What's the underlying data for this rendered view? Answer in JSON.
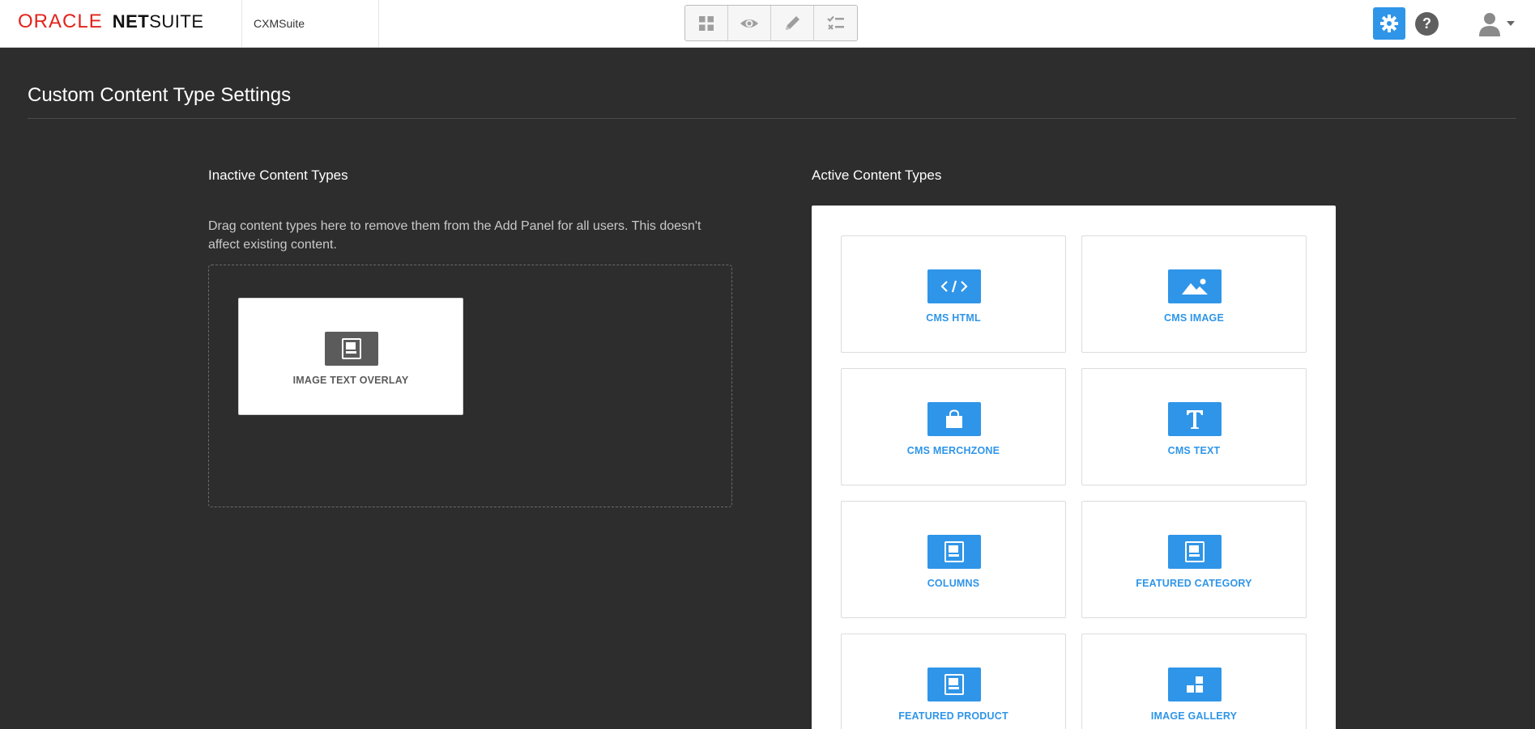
{
  "topbar": {
    "brand_oracle": "ORACLE",
    "brand_net": "NET",
    "brand_suite": "SUITE",
    "site_name": "CXMSuite",
    "modes": [
      {
        "icon": "grid-icon"
      },
      {
        "icon": "eye-icon"
      },
      {
        "icon": "pencil-icon"
      },
      {
        "icon": "checklist-icon"
      }
    ],
    "settings_icon": "gear-icon",
    "help_label": "?",
    "user_icon": "user-icon"
  },
  "page": {
    "title": "Custom Content Type Settings"
  },
  "inactive": {
    "heading": "Inactive Content Types",
    "description": "Drag content types here to remove them from the Add Panel for all users. This doesn't affect existing content.",
    "items": [
      {
        "label": "IMAGE TEXT OVERLAY",
        "icon": "placeholder-image-icon"
      }
    ]
  },
  "active": {
    "heading": "Active Content Types",
    "items": [
      {
        "label": "CMS HTML",
        "icon": "code-icon"
      },
      {
        "label": "CMS IMAGE",
        "icon": "landscape-image-icon"
      },
      {
        "label": "CMS MERCHZONE",
        "icon": "shopping-bag-icon"
      },
      {
        "label": "CMS TEXT",
        "icon": "text-t-icon"
      },
      {
        "label": "COLUMNS",
        "icon": "placeholder-image-icon"
      },
      {
        "label": "FEATURED CATEGORY",
        "icon": "placeholder-image-icon"
      },
      {
        "label": "FEATURED PRODUCT",
        "icon": "placeholder-image-icon"
      },
      {
        "label": "IMAGE GALLERY",
        "icon": "gallery-icon"
      }
    ]
  },
  "colors": {
    "accent": "#2f95e8",
    "background": "#2d2d2e",
    "inactive_icon": "#5b5b5b",
    "brand_red": "#e2231a"
  }
}
